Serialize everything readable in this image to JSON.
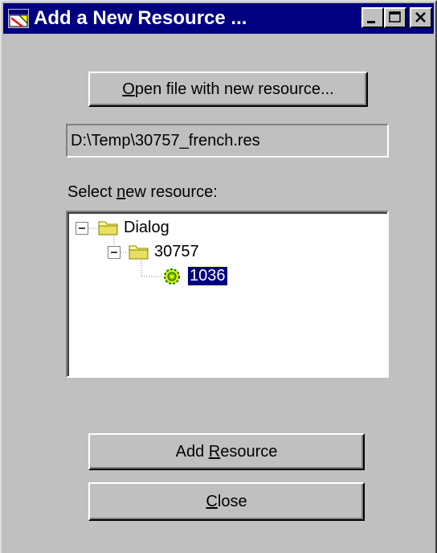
{
  "window": {
    "title": "Add a New Resource ...",
    "titlebar_color": "#000080",
    "face_color": "#c0c0c0"
  },
  "titlebar_buttons": {
    "minimize_icon": "minimize-icon",
    "maximize_icon": "maximize-icon",
    "close_icon": "close-icon"
  },
  "open_button": {
    "label_mnemonic": "O",
    "label_rest": "pen file with new resource..."
  },
  "path_field": {
    "value": "D:\\Temp\\30757_french.res"
  },
  "select_label": {
    "before": "Select ",
    "mnemonic": "n",
    "after": "ew resource:"
  },
  "tree": {
    "nodes": [
      {
        "label": "Dialog",
        "icon": "folder-icon",
        "expander": "minus"
      },
      {
        "label": "30757",
        "icon": "folder-icon",
        "expander": "minus"
      },
      {
        "label": "1036",
        "icon": "gear-resource-icon",
        "selected": true
      }
    ]
  },
  "add_button": {
    "label_before": "Add ",
    "label_mnemonic": "R",
    "label_after": "esource"
  },
  "close_button": {
    "label_mnemonic": "C",
    "label_after": "lose"
  }
}
